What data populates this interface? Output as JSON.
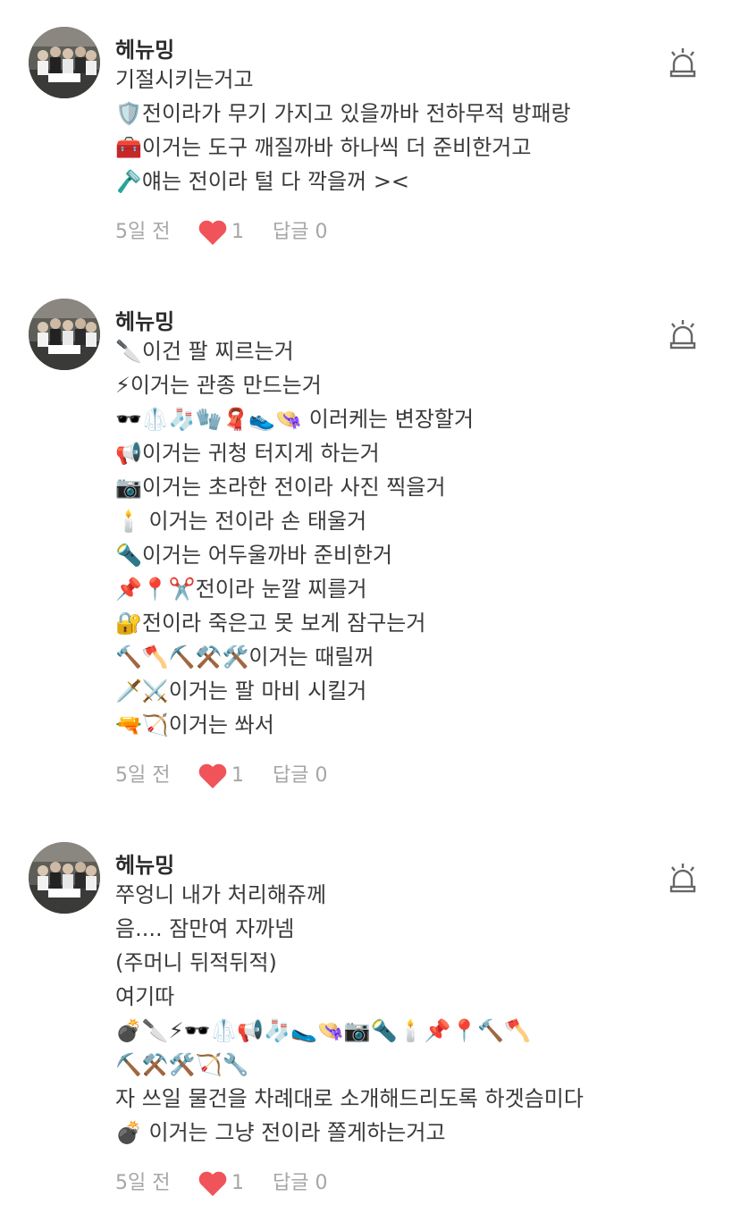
{
  "comments": [
    {
      "author": "헤뉴밍",
      "lines": [
        "기절시키는거고",
        "🛡️전이라가 무기 가지고 있을까바 전하무적 방패랑",
        "🧰이거는 도구 깨질까바 하나씩 더 준비한거고",
        "🪒얘는 전이라 털 다 깍을꺼 ><"
      ],
      "time": "5일 전",
      "likes": "1",
      "replies": "답글 0"
    },
    {
      "author": "헤뉴밍",
      "lines": [
        "🔪이건 팔 찌르는거",
        "⚡이거는 관종 만드는거",
        "🕶️🥼🧦🧤🧣👟👒 이러케는 변장할거",
        "📢이거는 귀청 터지게 하는거",
        "📷이거는 초라한 전이라 사진 찍을거",
        "🕯️ 이거는 전이라 손 태울거",
        "🔦이거는 어두울까바 준비한거",
        "📌📍✂️전이라 눈깔 찌를거",
        "🔐전이라 죽은고 못 보게 잠구는거",
        "🔨🪓⛏️⚒️🛠️이거는 때릴꺼",
        "🗡️⚔️이거는 팔 마비 시킬거",
        "🔫🏹이거는 쏴서"
      ],
      "time": "5일 전",
      "likes": "1",
      "replies": "답글 0"
    },
    {
      "author": "헤뉴밍",
      "lines": [
        "쭈엉니 내가 처리해쥬께",
        "음.... 잠만여 자까넴",
        "(주머니 뒤적뒤적)",
        "여기따",
        "💣🔪⚡🕶️🥼📢🧦🥿👒📷🔦🕯️📌📍🔨🪓",
        "⛏️⚒️🛠️🏹🔧",
        "자 쓰일 물건을 차례대로 소개해드리도록 하겟슴미다",
        "💣 이거는 그냥 전이라 쫄게하는거고"
      ],
      "time": "5일 전",
      "likes": "1",
      "replies": "답글 0"
    }
  ],
  "icons": {
    "report": "siren-icon",
    "like": "heart-icon",
    "avatar": "group-photo-avatar"
  },
  "colors": {
    "heart": "#f0535a",
    "meta_text": "#a6a6a6",
    "body_text": "#3a3a3a"
  }
}
